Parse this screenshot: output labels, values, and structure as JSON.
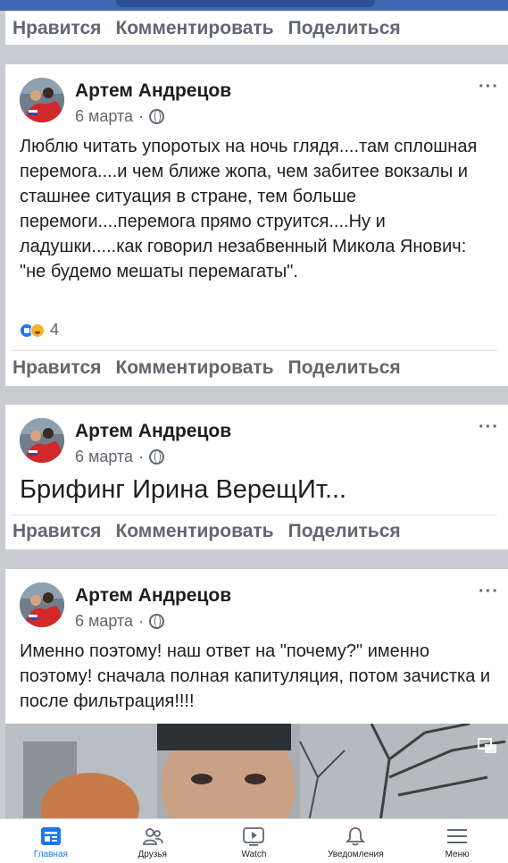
{
  "actions": {
    "like": "Нравится",
    "comment": "Комментировать",
    "share": "Поделиться"
  },
  "posts": [
    {
      "author": "Артем Андрецов",
      "date": "6 марта",
      "separator": "·",
      "text": "Люблю читать упоротых на ночь глядя....там сплошная перемога....и чем ближе жопа, чем забитее вокзалы и сташнее ситуация в стране, тем больше перемоги....перемога прямо струится....Ну и ладушки.....как говорил незабвенный Микола Янович:  \"не будемо мешаты перемагаты\".",
      "reaction_count": "4",
      "more": "···"
    },
    {
      "author": "Артем Андрецов",
      "date": "6 марта",
      "separator": "·",
      "text": "Брифинг Ирина ВерещИт...",
      "more": "···"
    },
    {
      "author": "Артем Андрецов",
      "date": "6 марта",
      "separator": "·",
      "text": "Именно поэтому! наш ответ на \"почему?\" именно поэтому! сначала полная капитуляция, потом зачистка и после фильтрация!!!!",
      "more": "···"
    }
  ],
  "nav": {
    "home": "Главная",
    "friends": "Друзья",
    "watch": "Watch",
    "notifications": "Уведомления",
    "menu": "Меню"
  },
  "colors": {
    "accent": "#1877f2",
    "text_secondary": "#606770",
    "topbar": "#4267b2"
  }
}
